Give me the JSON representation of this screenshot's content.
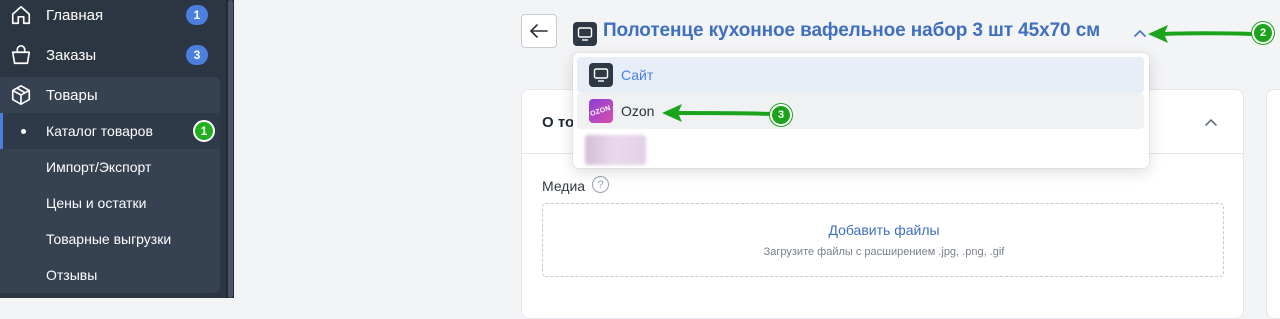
{
  "sidebar": {
    "items": [
      {
        "label": "Главная",
        "badge": "1",
        "icon": "home-icon"
      },
      {
        "label": "Заказы",
        "badge": "3",
        "icon": "basket-icon"
      },
      {
        "label": "Товары",
        "icon": "box-icon"
      }
    ],
    "sub_items": [
      {
        "label": "Каталог товаров",
        "annotation": "1"
      },
      {
        "label": "Импорт/Экспорт"
      },
      {
        "label": "Цены и остатки"
      },
      {
        "label": "Товарные выгрузки"
      },
      {
        "label": "Отзывы"
      }
    ]
  },
  "header": {
    "title": "Полотенце кухонное вафельное набор 3 шт 45x70 см",
    "annotation": "2"
  },
  "dropdown": {
    "options": [
      {
        "label": "Сайт",
        "icon": "monitor-icon",
        "selected": true
      },
      {
        "label": "Ozon",
        "icon": "ozon-logo-icon",
        "annotation": "3",
        "logo_text": "OZON"
      },
      {
        "label": "",
        "icon": "blurred-icon"
      }
    ]
  },
  "card": {
    "title": "О то",
    "media_label": "Медиа",
    "help_glyph": "?",
    "add_files": "Добавить файлы",
    "hint": "Загрузите файлы с расширением .jpg, .png, .gif"
  },
  "colors": {
    "sidebar_bg": "#2c3643",
    "accent_blue": "#4a7fe0",
    "title_blue": "#3e6fc0",
    "annotation_green": "#1ca31c"
  }
}
